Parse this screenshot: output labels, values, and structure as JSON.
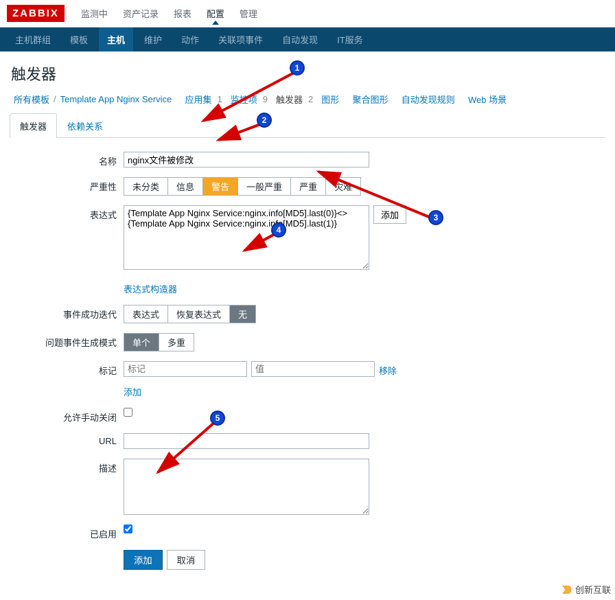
{
  "topbar": {
    "logo": "ZABBIX",
    "items": [
      "监测中",
      "资产记录",
      "报表",
      "配置",
      "管理"
    ],
    "active_index": 3
  },
  "subnav": {
    "items": [
      "主机群组",
      "模板",
      "主机",
      "维护",
      "动作",
      "关联项事件",
      "自动发现",
      "IT服务"
    ],
    "active_index": 2
  },
  "page_title": "触发器",
  "crumbs": {
    "all_templates": "所有模板",
    "sep": "/",
    "template_name": "Template App Nginx Service",
    "appset_label": "应用集",
    "appset_count": "1",
    "mon_label": "监控项",
    "mon_count": "9",
    "trig_label": "触发器",
    "trig_count": "2",
    "graph_label": "图形",
    "agggraph_label": "聚合图形",
    "discovery_label": "自动发现规则",
    "web_label": "Web 场景"
  },
  "tabs": {
    "tab1": "触发器",
    "tab2": "依赖关系"
  },
  "form": {
    "name_label": "名称",
    "name_value": "nginx文件被修改",
    "severity_label": "严重性",
    "sev_opts": [
      "未分类",
      "信息",
      "警告",
      "一般严重",
      "严重",
      "灾难"
    ],
    "expr_label": "表达式",
    "expr_value": "{Template App Nginx Service:nginx.info[MD5].last(0)}<>{Template App Nginx Service:nginx.info[MD5].last(1)}",
    "add_btn": "添加",
    "expr_builder": "表达式构造器",
    "iter_label": "事件成功迭代",
    "iter_opts": [
      "表达式",
      "恢复表达式",
      "无"
    ],
    "gen_label": "问题事件生成模式",
    "gen_opts": [
      "单个",
      "多重"
    ],
    "tag_label": "标记",
    "tag_ph1": "标记",
    "tag_ph2": "值",
    "tag_remove": "移除",
    "tag_add": "添加",
    "allow_close_label": "允许手动关闭",
    "url_label": "URL",
    "desc_label": "描述",
    "enabled_label": "已启用",
    "submit_add": "添加",
    "submit_cancel": "取消"
  },
  "watermark": "创新互联"
}
